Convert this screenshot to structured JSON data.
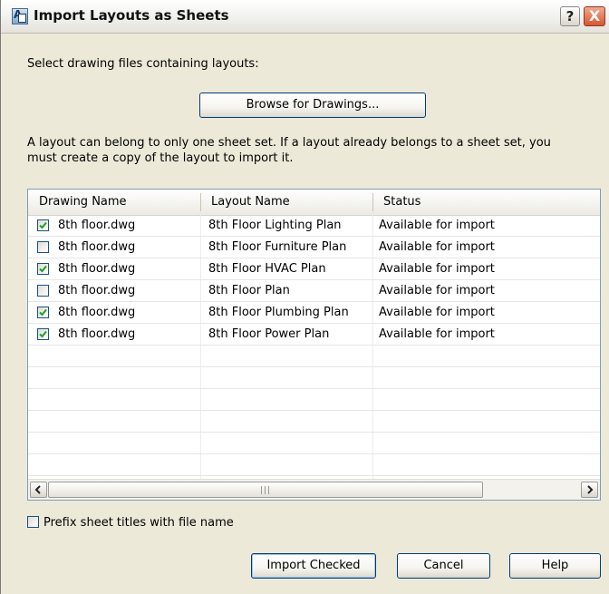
{
  "window": {
    "title": "Import Layouts as Sheets",
    "help_symbol": "?",
    "close_symbol": "X"
  },
  "select_label": "Select drawing files containing layouts:",
  "browse_button": "Browse for Drawings...",
  "info_line1": "A layout can belong to only one sheet set. If a layout already belongs to a sheet set, you",
  "info_line2": "must create a copy of the layout to import it.",
  "table": {
    "columns": [
      "Drawing Name",
      "Layout Name",
      "Status"
    ],
    "rows": [
      {
        "checked": true,
        "drawing": "8th floor.dwg",
        "layout": "8th Floor Lighting Plan",
        "status": "Available for import"
      },
      {
        "checked": false,
        "drawing": "8th floor.dwg",
        "layout": "8th Floor Furniture Plan",
        "status": "Available for import"
      },
      {
        "checked": true,
        "drawing": "8th floor.dwg",
        "layout": "8th Floor HVAC Plan",
        "status": "Available for import"
      },
      {
        "checked": false,
        "drawing": "8th floor.dwg",
        "layout": "8th Floor Plan",
        "status": "Available for import"
      },
      {
        "checked": true,
        "drawing": "8th floor.dwg",
        "layout": "8th Floor Plumbing Plan",
        "status": "Available for import"
      },
      {
        "checked": true,
        "drawing": "8th floor.dwg",
        "layout": "8th Floor Power Plan",
        "status": "Available for import"
      }
    ]
  },
  "prefix_option": {
    "label": "Prefix sheet titles with file name",
    "checked": false
  },
  "buttons": {
    "import_checked": "Import Checked",
    "cancel": "Cancel",
    "help": "Help"
  },
  "colors": {
    "dialog_bg": "#ece9d8",
    "check_color": "#21a121",
    "button_border": "#003c74",
    "close_red": "#d9552f"
  },
  "icons": {
    "app": "autocad-sheetset-icon",
    "scroll_left": "arrow-left-icon",
    "scroll_right": "arrow-right-icon",
    "check": "checkmark-icon"
  }
}
